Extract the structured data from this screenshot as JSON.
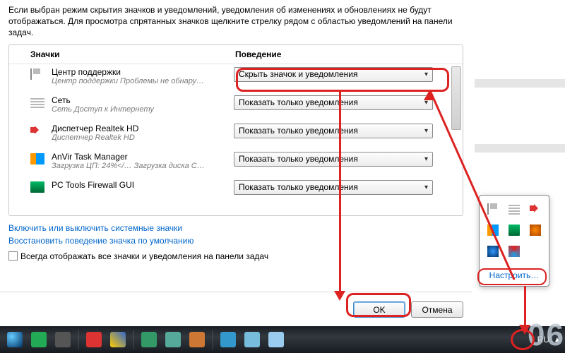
{
  "intro": "Если выбран режим скрытия значков и уведомлений, уведомления об изменениях и обновлениях не будут отображаться. Для просмотра спрятанных значков щелкните стрелку рядом с областью уведомлений на панели задач.",
  "columns": {
    "icons": "Значки",
    "behavior": "Поведение"
  },
  "dropdown": {
    "hide": "Скрыть значок и уведомления",
    "notify_only": "Показать только уведомления"
  },
  "rows": [
    {
      "name": "Центр поддержки",
      "sub": "Центр поддержки  Проблемы не обнару…",
      "value_key": "hide"
    },
    {
      "name": "Сеть",
      "sub": "Сеть Доступ к Интернету",
      "value_key": "notify_only"
    },
    {
      "name": "Диспетчер Realtek HD",
      "sub": "Диспетчер Realtek HD",
      "value_key": "notify_only"
    },
    {
      "name": "AnVir Task Manager",
      "sub": "Загрузка ЦП: 24%</…   Загрузка диска  С…",
      "value_key": "notify_only"
    },
    {
      "name": "PC Tools Firewall GUI",
      "sub": "",
      "value_key": "notify_only"
    }
  ],
  "links": {
    "toggle_system": "Включить или выключить системные значки",
    "restore_default": "Восстановить поведение значка по умолчанию"
  },
  "checkbox_label": "Всегда отображать все значки и уведомления на панели задач",
  "buttons": {
    "ok": "OK",
    "cancel": "Отмена"
  },
  "popup_link": "Настроить…",
  "taskbar": {
    "lang": "RU"
  },
  "overlay_digits": "06"
}
